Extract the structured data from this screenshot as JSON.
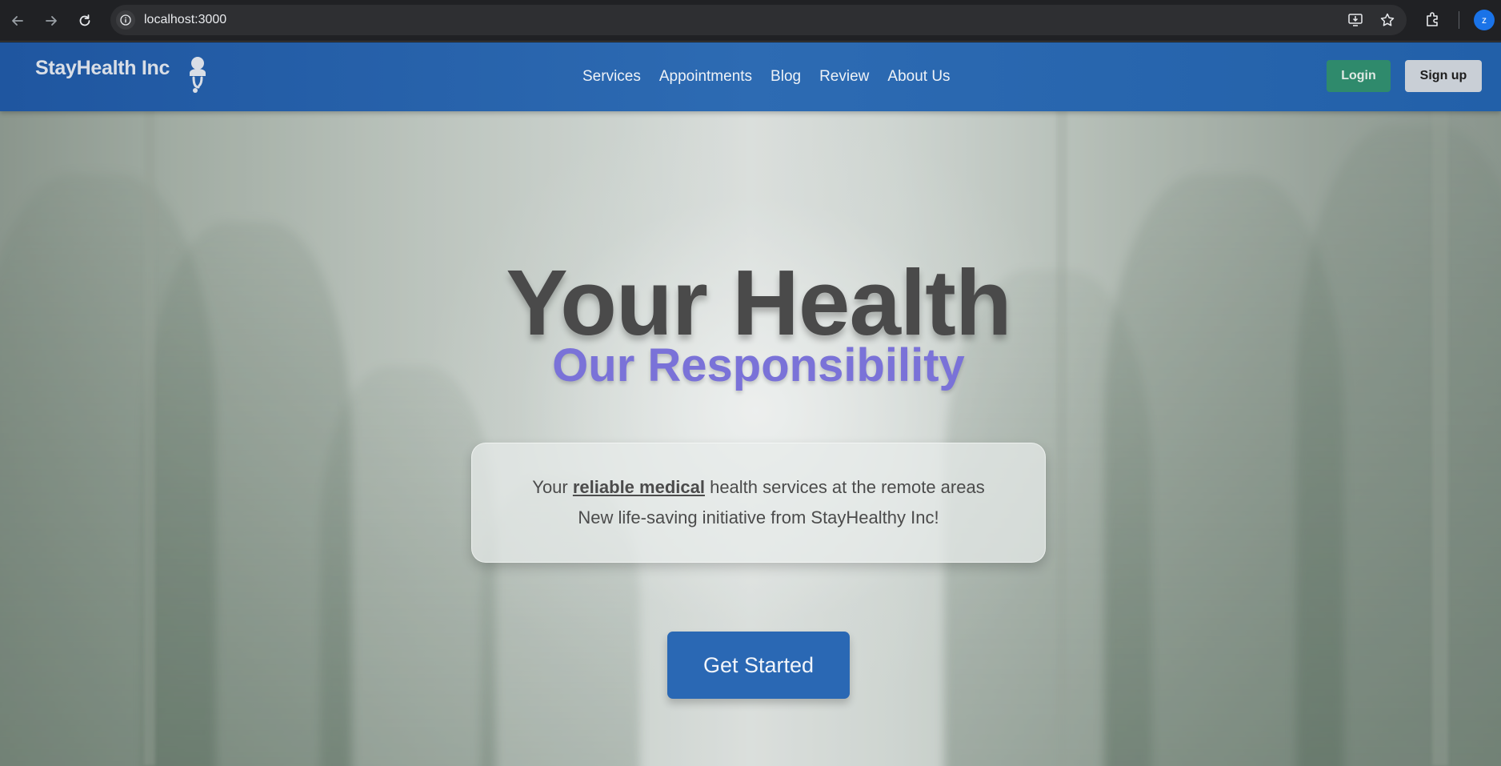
{
  "browser": {
    "url": "localhost:3000",
    "profile_initial": "z",
    "icons": [
      "back-arrow-icon",
      "forward-arrow-icon",
      "reload-icon",
      "site-info-icon",
      "install-app-icon",
      "bookmark-star-icon",
      "extensions-icon"
    ]
  },
  "header": {
    "brand": "StayHealth Inc",
    "logo_icon": "doctor-stethoscope-icon",
    "nav": [
      "Services",
      "Appointments",
      "Blog",
      "Review",
      "About Us"
    ],
    "login_label": "Login",
    "signup_label": "Sign up",
    "colors": {
      "bar": "#2a62ad",
      "login": "#2f8a6c",
      "signup": "#c9cfd6"
    }
  },
  "hero": {
    "title": "Your Health",
    "subtitle": "Our Responsibility",
    "card": {
      "line1_pre": "Your ",
      "line1_strong": "reliable medical",
      "line1_post": " health services at the remote areas",
      "line2": "New life-saving initiative from StayHealthy Inc!"
    },
    "cta_label": "Get Started",
    "colors": {
      "title": "#4a4a4a",
      "subtitle": "#7a72d8",
      "cta": "#2a68b4"
    }
  }
}
